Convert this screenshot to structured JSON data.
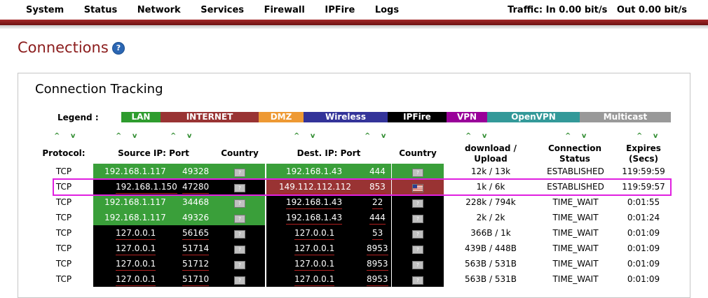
{
  "nav": {
    "items": [
      "System",
      "Status",
      "Network",
      "Services",
      "Firewall",
      "IPFire",
      "Logs"
    ],
    "traffic": "Traffic: In 0.00 bit/s   Out 0.00 bit/s"
  },
  "page": {
    "title": "Connections",
    "help_icon": "question-icon"
  },
  "section": {
    "title": "Connection Tracking"
  },
  "legend": {
    "label": "Legend :",
    "items": [
      {
        "label": "LAN",
        "color": "#2e9c2e"
      },
      {
        "label": "INTERNET",
        "color": "#993333"
      },
      {
        "label": "DMZ",
        "color": "#ee9933"
      },
      {
        "label": "Wireless",
        "color": "#333399"
      },
      {
        "label": "IPFire",
        "color": "#000000"
      },
      {
        "label": "VPN",
        "color": "#990099"
      },
      {
        "label": "OpenVPN",
        "color": "#339999"
      },
      {
        "label": "Multicast",
        "color": "#999999"
      }
    ]
  },
  "columns": {
    "protocol": "Protocol:",
    "source": "Source IP: Port",
    "country": "Country",
    "dest": "Dest. IP: Port",
    "country2": "Country",
    "transfer_line1": "download /",
    "transfer_line2": "Upload",
    "status_line1": "Connection",
    "status_line2": "Status",
    "expires_line1": "Expires",
    "expires_line2": "(Secs)"
  },
  "rows": [
    {
      "protocol": "TCP",
      "src_ip": "192.168.1.117",
      "src_port": "49328",
      "src_zone": "LAN",
      "dst_ip": "192.168.1.43",
      "dst_port": "444",
      "dst_zone": "LAN",
      "dst_flag": "unknown",
      "transfer": "12k / 13k",
      "status": "ESTABLISHED",
      "expires": "119:59:59"
    },
    {
      "protocol": "TCP",
      "src_ip": "192.168.1.150",
      "src_port": "47280",
      "src_zone": "IPFIRE",
      "dst_ip": "149.112.112.112",
      "dst_port": "853",
      "dst_zone": "INTERNET",
      "dst_flag": "us",
      "transfer": "1k / 6k",
      "status": "ESTABLISHED",
      "expires": "119:59:57"
    },
    {
      "protocol": "TCP",
      "src_ip": "192.168.1.117",
      "src_port": "34468",
      "src_zone": "LAN",
      "dst_ip": "192.168.1.43",
      "dst_port": "22",
      "dst_zone": "IPFIRE",
      "dst_flag": "unknown",
      "transfer": "228k / 794k",
      "status": "TIME_WAIT",
      "expires": "0:01:55"
    },
    {
      "protocol": "TCP",
      "src_ip": "192.168.1.117",
      "src_port": "49326",
      "src_zone": "LAN",
      "dst_ip": "192.168.1.43",
      "dst_port": "444",
      "dst_zone": "IPFIRE",
      "dst_flag": "unknown",
      "transfer": "2k / 2k",
      "status": "TIME_WAIT",
      "expires": "0:01:24"
    },
    {
      "protocol": "TCP",
      "src_ip": "127.0.0.1",
      "src_port": "56165",
      "src_zone": "IPFIRE",
      "dst_ip": "127.0.0.1",
      "dst_port": "53",
      "dst_zone": "IPFIRE",
      "dst_flag": "unknown",
      "transfer": "366B / 1k",
      "status": "TIME_WAIT",
      "expires": "0:01:09"
    },
    {
      "protocol": "TCP",
      "src_ip": "127.0.0.1",
      "src_port": "51714",
      "src_zone": "IPFIRE",
      "dst_ip": "127.0.0.1",
      "dst_port": "8953",
      "dst_zone": "IPFIRE",
      "dst_flag": "unknown",
      "transfer": "439B / 448B",
      "status": "TIME_WAIT",
      "expires": "0:01:09"
    },
    {
      "protocol": "TCP",
      "src_ip": "127.0.0.1",
      "src_port": "51712",
      "src_zone": "IPFIRE",
      "dst_ip": "127.0.0.1",
      "dst_port": "8953",
      "dst_zone": "IPFIRE",
      "dst_flag": "unknown",
      "transfer": "563B / 531B",
      "status": "TIME_WAIT",
      "expires": "0:01:09"
    },
    {
      "protocol": "TCP",
      "src_ip": "127.0.0.1",
      "src_port": "51710",
      "src_zone": "IPFIRE",
      "dst_ip": "127.0.0.1",
      "dst_port": "8953",
      "dst_zone": "IPFIRE",
      "dst_flag": "unknown",
      "transfer": "563B / 531B",
      "status": "TIME_WAIT",
      "expires": "0:01:09"
    }
  ],
  "zone_colors": {
    "LAN": "#3a9f3a",
    "INTERNET": "#993333",
    "IPFIRE": "#000000"
  }
}
